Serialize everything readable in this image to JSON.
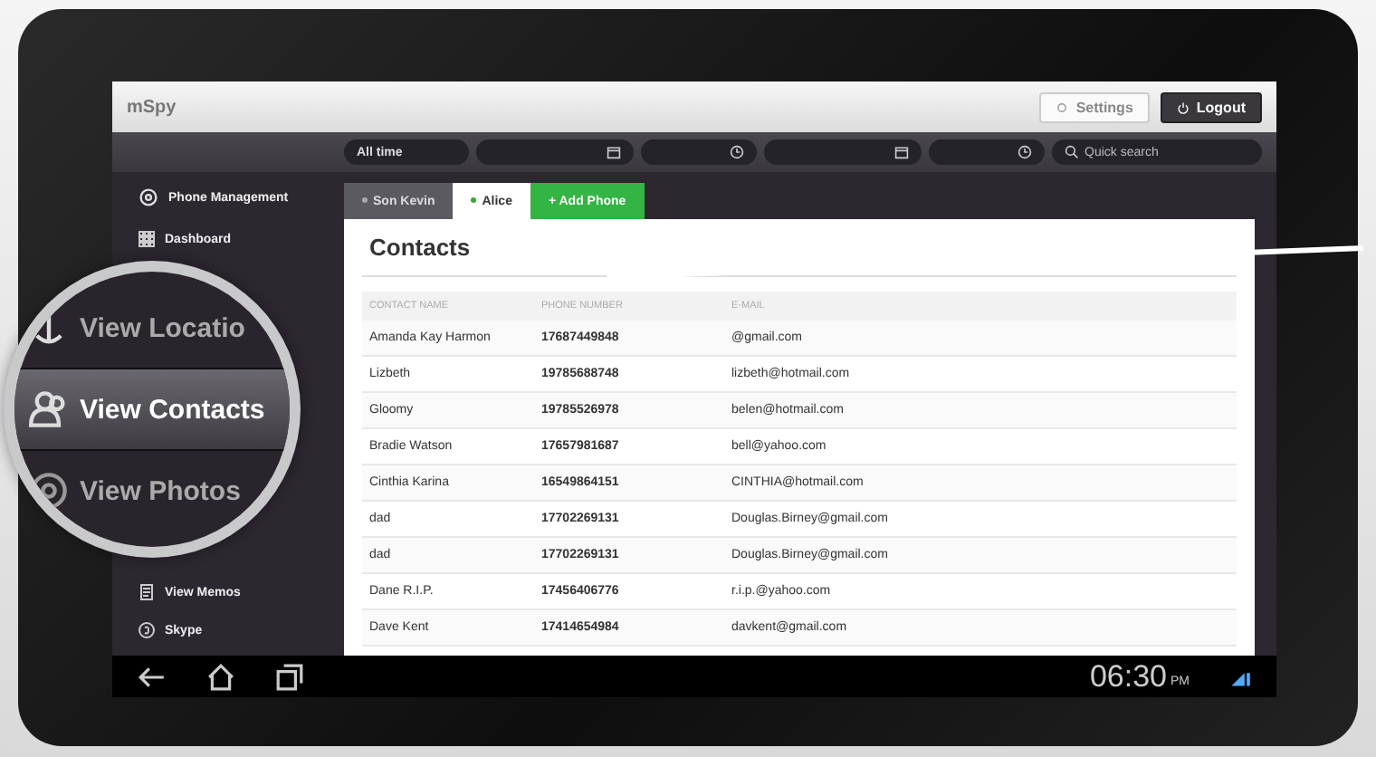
{
  "app": {
    "logo": "mSpy",
    "settings": "Settings",
    "logout": "Logout"
  },
  "filters": {
    "period": "All time",
    "search_placeholder": "Quick search"
  },
  "sidebar": {
    "header": "Phone Management",
    "items": [
      {
        "label": "Dashboard"
      },
      {
        "label": "View Memos"
      },
      {
        "label": "Skype"
      }
    ]
  },
  "magnifier": {
    "items": [
      {
        "label": "View Locatio",
        "selected": false
      },
      {
        "label": "View Contacts",
        "selected": true
      },
      {
        "label": "View Photos",
        "selected": false
      }
    ]
  },
  "phone_tabs": [
    {
      "label": "Son Kevin",
      "selected": false,
      "kind": "phone"
    },
    {
      "label": "Alice",
      "selected": true,
      "kind": "phone"
    },
    {
      "label": "+ Add Phone",
      "kind": "add"
    }
  ],
  "contacts": {
    "title": "Contacts",
    "columns": [
      "CONTACT NAME",
      "PHONE NUMBER",
      "E-MAIL"
    ],
    "rows": [
      [
        "Amanda Kay Harmon",
        "17687449848",
        "@gmail.com"
      ],
      [
        "Lizbeth",
        "19785688748",
        "lizbeth@hotmail.com"
      ],
      [
        "Gloomy",
        "19785526978",
        "belen@hotmail.com"
      ],
      [
        "Bradie Watson",
        "17657981687",
        "bell@yahoo.com"
      ],
      [
        "Cinthia Karina",
        "16549864151",
        "CINTHIA@hotmail.com"
      ],
      [
        "dad",
        "17702269131",
        "Douglas.Birney@gmail.com"
      ],
      [
        "dad",
        "17702269131",
        "Douglas.Birney@gmail.com"
      ],
      [
        "Dane R.I.P.",
        "17456406776",
        "r.i.p.@yahoo.com"
      ],
      [
        "Dave Kent",
        "17414654984",
        "davkent@gmail.com"
      ]
    ]
  },
  "status_bar": {
    "time": "06:30",
    "ampm": "PM"
  }
}
